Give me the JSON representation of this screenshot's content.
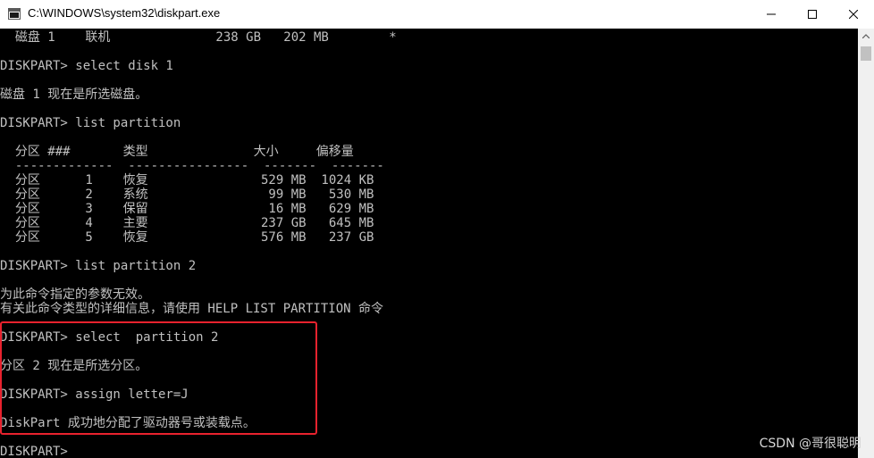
{
  "window": {
    "title": "C:\\WINDOWS\\system32\\diskpart.exe",
    "controls": {
      "minimize": "—",
      "maximize": "☐",
      "close": "✕"
    }
  },
  "console": {
    "lines": [
      "  磁盘 1    联机              238 GB   202 MB        *",
      "",
      "DISKPART> select disk 1",
      "",
      "磁盘 1 现在是所选磁盘。",
      "",
      "DISKPART> list partition",
      "",
      "  分区 ###       类型              大小     偏移量",
      "  -------------  ----------------  -------  -------",
      "  分区      1    恢复               529 MB  1024 KB",
      "  分区      2    系统                99 MB   530 MB",
      "  分区      3    保留                16 MB   629 MB",
      "  分区      4    主要               237 GB   645 MB",
      "  分区      5    恢复               576 MB   237 GB",
      "",
      "DISKPART> list partition 2",
      "",
      "为此命令指定的参数无效。",
      "有关此命令类型的详细信息，请使用 HELP LIST PARTITION 命令",
      "",
      "DISKPART> select  partition 2",
      "",
      "分区 2 现在是所选分区。",
      "",
      "DISKPART> assign letter=J",
      "",
      "DiskPart 成功地分配了驱动器号或装载点。",
      "",
      "DISKPART> "
    ]
  },
  "watermark": "CSDN @哥很聪明",
  "colors": {
    "console_bg": "#000000",
    "console_fg": "#c0c0c0",
    "highlight": "#e8222e"
  },
  "icons": {
    "app": "console-window-icon",
    "scroll_up": "chevron-up-icon"
  }
}
